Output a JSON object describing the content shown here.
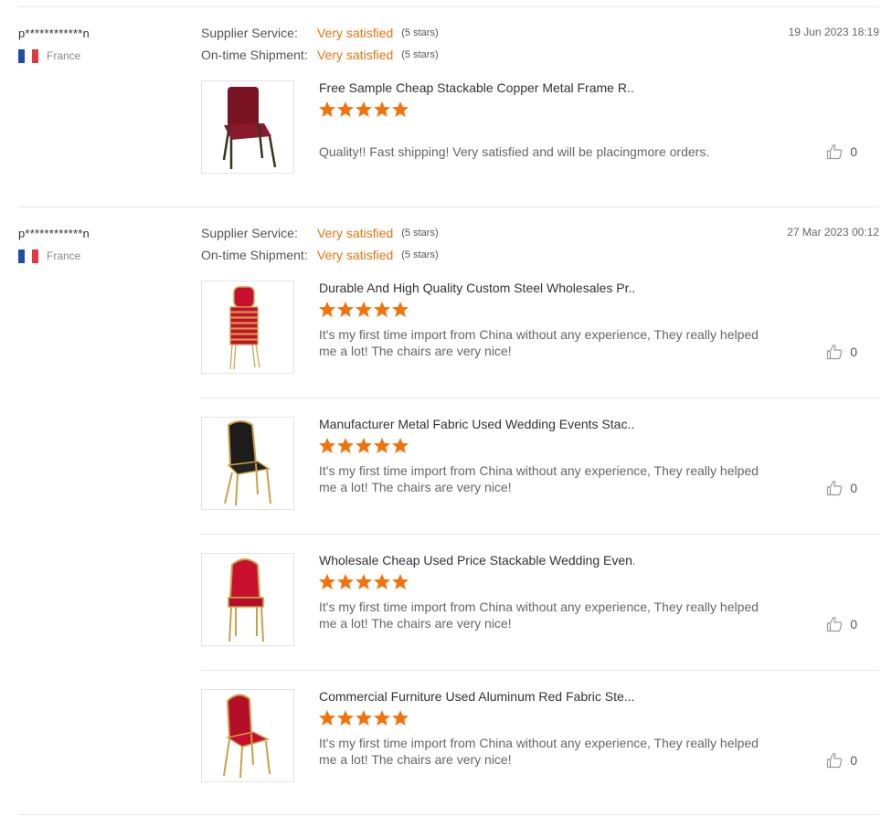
{
  "colors": {
    "accent": "#e87410",
    "star": "#f4720c",
    "divider": "#e6e6e6"
  },
  "labels": {
    "supplier_service": "Supplier Service:",
    "on_time_shipment": "On-time Shipment:"
  },
  "reviews": [
    {
      "user": "p************n",
      "country": "France",
      "flag_icon": "france-flag-icon",
      "date": "19 Jun 2023 18:19",
      "supplier_service": {
        "value": "Very satisfied",
        "stars_text": "(5 stars)",
        "stars": 5
      },
      "on_time_shipment": {
        "value": "Very satisfied",
        "stars_text": "(5 stars)",
        "stars": 5
      },
      "items": [
        {
          "title": "Free Sample Cheap Stackable Copper Metal Frame R...",
          "rating": 5,
          "comment": "Quality!! Fast shipping! Very satisfied and will be placingmore orders.",
          "likes": "0",
          "image": "burgundy-church-chair"
        }
      ]
    },
    {
      "user": "p************n",
      "country": "France",
      "flag_icon": "france-flag-icon",
      "date": "27 Mar 2023 00:12",
      "supplier_service": {
        "value": "Very satisfied",
        "stars_text": "(5 stars)",
        "stars": 5
      },
      "on_time_shipment": {
        "value": "Very satisfied",
        "stars_text": "(5 stars)",
        "stars": 5
      },
      "items": [
        {
          "title": "Durable And High Quality Custom Steel Wholesales Pr...",
          "rating": 5,
          "comment": "It's my first time import from China without any experience, They really helped me a lot! The chairs are very nice!",
          "likes": "0",
          "image": "stacked-red-chairs"
        },
        {
          "title": "Manufacturer Metal Fabric Used Wedding Events Stac...",
          "rating": 5,
          "comment": "It's my first time import from China without any experience, They really helped me a lot! The chairs are very nice!",
          "likes": "0",
          "image": "black-gold-banquet-chair"
        },
        {
          "title": "Wholesale Cheap Used Price Stackable Wedding Even...",
          "rating": 5,
          "comment": "It's my first time import from China without any experience, They really helped me a lot! The chairs are very nice!",
          "likes": "0",
          "image": "red-gold-banquet-chair"
        },
        {
          "title": "Commercial Furniture Used Aluminum Red Fabric Ste...",
          "rating": 5,
          "comment": "It's my first time import from China without any experience, They really helped me a lot! The chairs are very nice!",
          "likes": "0",
          "image": "red-gold-banquet-chair-angled"
        }
      ]
    }
  ]
}
